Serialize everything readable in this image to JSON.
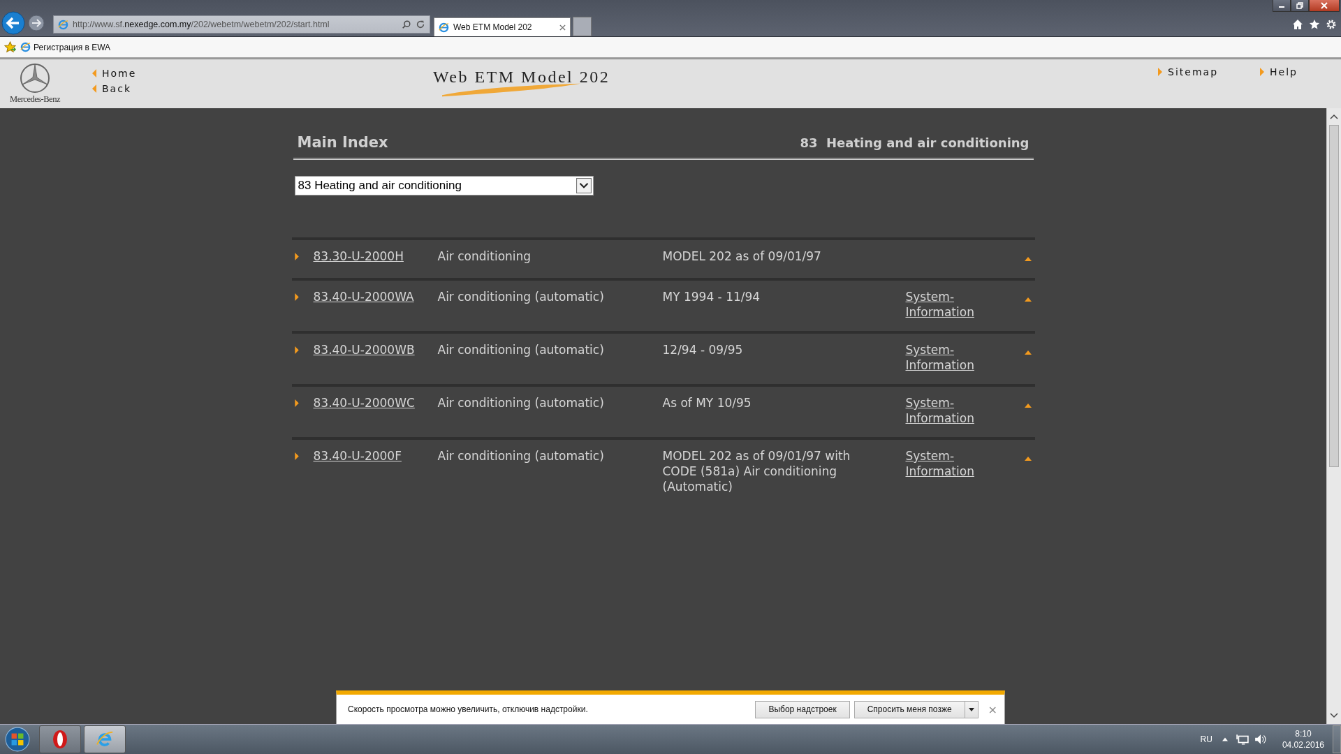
{
  "browser": {
    "address": "http://www.sf.**nexedge.com.my**/202/webetm/webetm/202/start.html",
    "tabs": [
      {
        "title": "Web ETM Model 202",
        "selected": true
      }
    ],
    "favorites": [
      {
        "label": "Регистрация в EWA"
      }
    ]
  },
  "header": {
    "logo_text": "Mercedes-Benz",
    "title": "Web ETM Model 202",
    "nav_left": [
      {
        "label": "Home"
      },
      {
        "label": "Back"
      }
    ],
    "nav_right": [
      {
        "label": "Sitemap"
      },
      {
        "label": "Help"
      }
    ]
  },
  "page": {
    "heading": "Main Index",
    "section_number": "83",
    "section_title": "Heating and air conditioning",
    "select": {
      "value": "83 Heating and air conditioning"
    },
    "rows": [
      {
        "code": "83.30-U-2000H",
        "title": "Air conditioning",
        "validity": "MODEL 202 as of 09/01/97"
      },
      {
        "code": "83.40-U-2000WA",
        "title": "Air conditioning (automatic)",
        "validity": "MY 1994 - 11/94",
        "link": "System-Information"
      },
      {
        "code": "83.40-U-2000WB",
        "title": "Air conditioning (automatic)",
        "validity": "12/94 - 09/95",
        "link": "System-Information"
      },
      {
        "code": "83.40-U-2000WC",
        "title": "Air conditioning (automatic)",
        "validity": "As of MY 10/95",
        "link": "System-Information"
      },
      {
        "code": "83.40-U-2000F",
        "title": "Air conditioning (automatic)",
        "validity": "MODEL 202 as of 09/01/97 with CODE (581a) Air conditioning (Automatic)",
        "link": "System-Information"
      }
    ]
  },
  "notification": {
    "message": "Скорость просмотра можно увеличить, отключив надстройки.",
    "buttons": [
      {
        "label": "Выбор надстроек",
        "kind": "plain"
      },
      {
        "label": "Спросить меня позже",
        "kind": "split"
      }
    ],
    "close": "×"
  },
  "taskbar": {
    "language": "RU",
    "time": "8:10",
    "date": "04.02.2016"
  }
}
